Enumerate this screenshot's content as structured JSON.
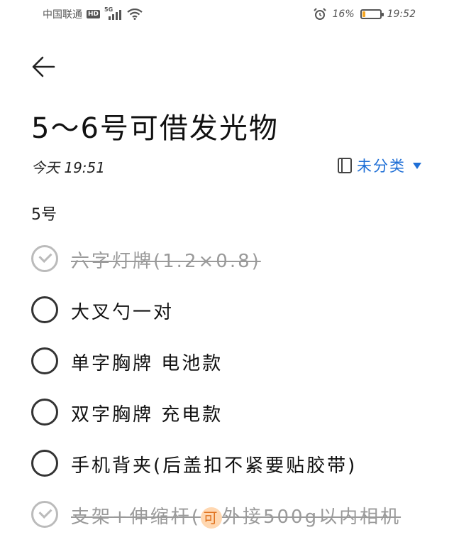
{
  "status_bar": {
    "carrier": "中国联通",
    "hd": "HD",
    "network": "5G",
    "battery_percent_text": "16%",
    "battery_level": 0.16,
    "time": "19:52"
  },
  "note": {
    "title": "5～6号可借发光物",
    "date": "今天  19:51",
    "category": "未分类",
    "section": "5号"
  },
  "items": [
    {
      "text": "六字灯牌(1.2×0.8)",
      "done": true
    },
    {
      "text": "大叉勺一对",
      "done": false
    },
    {
      "text": "单字胸牌 电池款",
      "done": false
    },
    {
      "text": "双字胸牌 充电款",
      "done": false
    },
    {
      "text": "手机背夹(后盖扣不紧要贴胶带)",
      "done": false
    },
    {
      "text_before": "支架+伸缩杆(",
      "chip": "可",
      "text_after": "外接500g以内相机",
      "done": true
    }
  ],
  "colors": {
    "accent": "#1f6fd6",
    "done_gray": "#9a9a9a",
    "battery_low": "#f5a623"
  }
}
